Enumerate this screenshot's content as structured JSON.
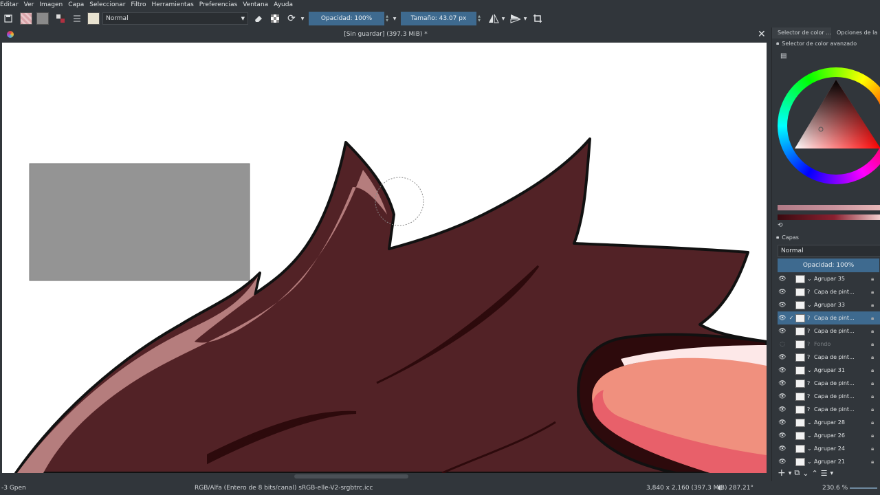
{
  "menu": [
    "Editar",
    "Ver",
    "Imagen",
    "Capa",
    "Seleccionar",
    "Filtro",
    "Herramientas",
    "Preferencias",
    "Ventana",
    "Ayuda"
  ],
  "toolbar": {
    "blend_mode": "Normal",
    "opacity_label": "Opacidad: 100%",
    "size_label": "Tamaño: 43.07 px"
  },
  "document": {
    "title": "[Sin guardar]  (397.3 MiB) *"
  },
  "dock": {
    "tabs": [
      "Selector de color ...",
      "Opciones de la"
    ],
    "color_panel_title": "Selector de color avanzado",
    "layers_panel_title": "Capas",
    "layers_blend_mode": "Normal",
    "layers_opacity": "Opacidad:  100%",
    "layers": [
      {
        "name": "Agrupar 35",
        "group": true,
        "selected": false,
        "dim": false
      },
      {
        "name": "Capa de pint...",
        "group": false,
        "selected": false,
        "dim": false
      },
      {
        "name": "Agrupar 33",
        "group": true,
        "selected": false,
        "dim": false
      },
      {
        "name": "Capa de pint...",
        "group": false,
        "selected": true,
        "dim": false
      },
      {
        "name": "Capa de pint...",
        "group": false,
        "selected": false,
        "dim": false
      },
      {
        "name": "Fondo",
        "group": false,
        "selected": false,
        "dim": true
      },
      {
        "name": "Capa de pint...",
        "group": false,
        "selected": false,
        "dim": false
      },
      {
        "name": "Agrupar 31",
        "group": true,
        "selected": false,
        "dim": false
      },
      {
        "name": "Capa de pint...",
        "group": false,
        "selected": false,
        "dim": false
      },
      {
        "name": "Capa de pint...",
        "group": false,
        "selected": false,
        "dim": false
      },
      {
        "name": "Capa de pint...",
        "group": false,
        "selected": false,
        "dim": false
      },
      {
        "name": "Agrupar 28",
        "group": true,
        "selected": false,
        "dim": false
      },
      {
        "name": "Agrupar 26",
        "group": true,
        "selected": false,
        "dim": false
      },
      {
        "name": "Agrupar 24",
        "group": true,
        "selected": false,
        "dim": false
      },
      {
        "name": "Agrupar 21",
        "group": true,
        "selected": false,
        "dim": false
      }
    ]
  },
  "status": {
    "brush": "-3 Gpen",
    "color_space": "RGB/Alfa (Entero de 8 bits/canal)  sRGB-elle-V2-srgbtrc.icc",
    "dimensions": "3,840 x 2,160 (397.3 MiB)",
    "rotation": "287.21°",
    "zoom": "230.6 %"
  },
  "colors": {
    "accent": "#3e6a8f",
    "hair": "#522226",
    "hair_highlight": "#b57d7d",
    "hair_shadow": "#2d0a0c",
    "cap_light": "#f0907e",
    "cap_pink": "#e8606a"
  }
}
